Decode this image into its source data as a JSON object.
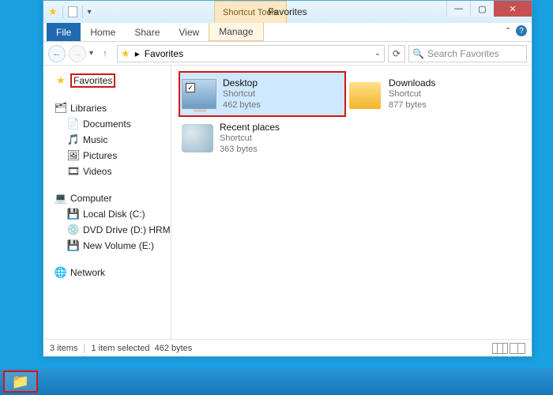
{
  "titlebar": {
    "title": "Favorites",
    "context_tab": "Shortcut Tools"
  },
  "ribbon": {
    "file": "File",
    "home": "Home",
    "share": "Share",
    "view": "View",
    "manage": "Manage"
  },
  "address": {
    "sep": "▸",
    "location": "Favorites"
  },
  "search": {
    "placeholder": "Search Favorites"
  },
  "sidebar": {
    "favorites": "Favorites",
    "libraries": "Libraries",
    "lib_items": [
      "Documents",
      "Music",
      "Pictures",
      "Videos"
    ],
    "computer": "Computer",
    "drives": [
      "Local Disk (C:)",
      "DVD Drive (D:) HRM",
      "New Volume (E:)"
    ],
    "network": "Network"
  },
  "items": [
    {
      "name": "Desktop",
      "type": "Shortcut",
      "size": "462 bytes",
      "selected": true,
      "checked": true,
      "kind": "monitor",
      "redborder": true
    },
    {
      "name": "Downloads",
      "type": "Shortcut",
      "size": "877 bytes",
      "selected": false,
      "kind": "folder"
    },
    {
      "name": "Recent places",
      "type": "Shortcut",
      "size": "363 bytes",
      "selected": false,
      "kind": "recent"
    }
  ],
  "status": {
    "count": "3 items",
    "sel": "1 item selected",
    "size": "462 bytes"
  }
}
